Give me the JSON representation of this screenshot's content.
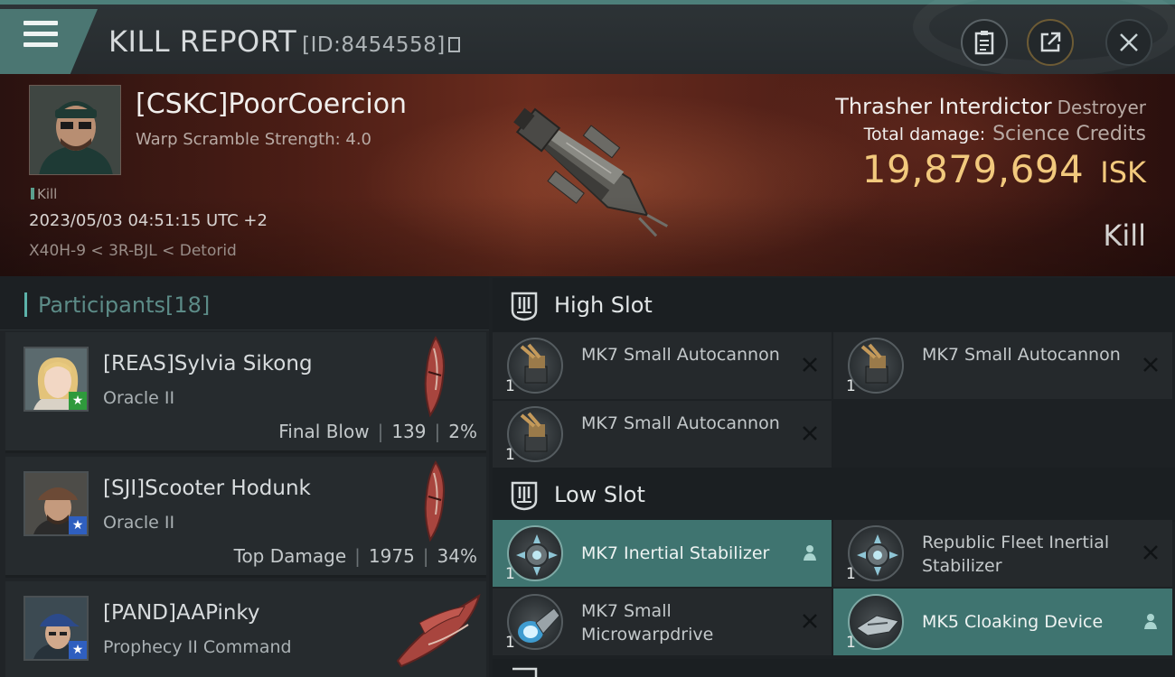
{
  "header": {
    "title": "KILL REPORT",
    "id_label": "[ID:8454558]"
  },
  "victim": {
    "name": "[CSKC]PoorCoercion",
    "subtitle": "Warp Scramble Strength: 4.0",
    "tag": "Kill",
    "timestamp": "2023/05/03 04:51:15 UTC +2",
    "location": "X40H-9 < 3R-BJL < Detorid",
    "ship_name": "Thrasher Interdictor",
    "ship_class": "Destroyer",
    "damage_label": "Total damage:",
    "damage_value": "Science Credits",
    "isk_value": "19,879,694",
    "isk_unit": "ISK",
    "result": "Kill"
  },
  "participants": {
    "label": "Participants",
    "count": "[18]",
    "items": [
      {
        "name": "[REAS]Sylvia Sikong",
        "ship": "Oracle II",
        "role": "Final Blow",
        "damage": "139",
        "percent": "2%",
        "badge_color": "#2f9a3c"
      },
      {
        "name": "[SJI]Scooter Hodunk",
        "ship": "Oracle II",
        "role": "Top Damage",
        "damage": "1975",
        "percent": "34%",
        "badge_color": "#2f5fbf"
      },
      {
        "name": "[PAND]AAPinky",
        "ship": "Prophecy II Command",
        "role": "",
        "damage": "",
        "percent": "",
        "badge_color": "#2f5fbf"
      }
    ]
  },
  "slots": {
    "high": {
      "title": "High Slot",
      "modules": [
        {
          "name": "MK7 Small Autocannon",
          "qty": "1"
        },
        {
          "name": "MK7 Small Autocannon",
          "qty": "1"
        },
        {
          "name": "MK7 Small Autocannon",
          "qty": "1"
        }
      ]
    },
    "low": {
      "title": "Low Slot",
      "modules": [
        {
          "name": "MK7 Inertial Stabilizer",
          "qty": "1"
        },
        {
          "name": "Republic Fleet Inertial Stabilizer",
          "qty": "1"
        },
        {
          "name": "MK7 Small Microwarpdrive",
          "qty": "1"
        },
        {
          "name": "MK5 Cloaking Device",
          "qty": "1"
        }
      ]
    }
  },
  "icons": {
    "menu": "hamburger-icon",
    "clipboard": "clipboard-icon",
    "share": "share-icon",
    "close": "close-icon",
    "copy": "copy-icon",
    "fitted": "person-icon",
    "dropped": "x-icon"
  },
  "colors": {
    "accent": "#4b7672",
    "isk": "#f2c97d",
    "fitted_module": "#3f7470",
    "participants_label": "#5c8b87"
  }
}
